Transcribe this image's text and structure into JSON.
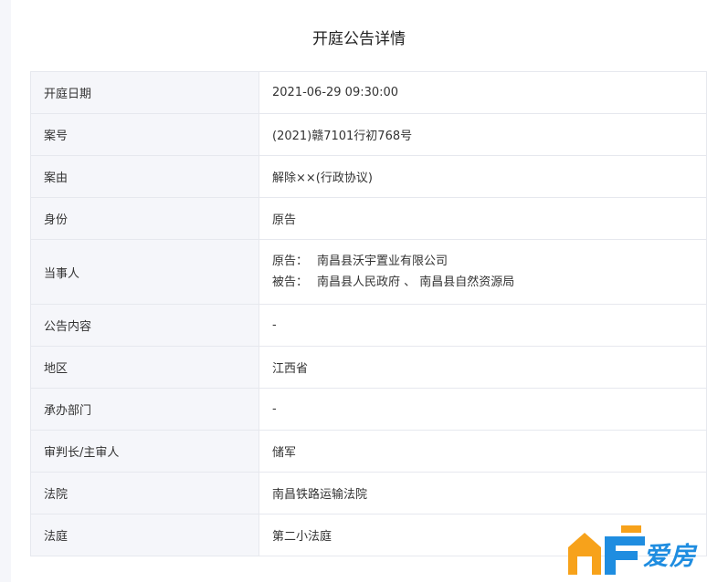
{
  "page": {
    "title": "开庭公告详情"
  },
  "details": [
    {
      "label": "开庭日期",
      "value": "2021-06-29 09:30:00"
    },
    {
      "label": "案号",
      "value": "(2021)赣7101行初768号"
    },
    {
      "label": "案由",
      "value": "解除××(行政协议)"
    },
    {
      "label": "身份",
      "value": "原告"
    },
    {
      "label": "当事人",
      "parties": [
        {
          "role": "原告：",
          "names": "南昌县沃宇置业有限公司"
        },
        {
          "role": "被告：",
          "names": "南昌县人民政府 、 南昌县自然资源局"
        }
      ]
    },
    {
      "label": "公告内容",
      "value": "-"
    },
    {
      "label": "地区",
      "value": "江西省"
    },
    {
      "label": "承办部门",
      "value": "-"
    },
    {
      "label": "审判长/主审人",
      "value": "储军"
    },
    {
      "label": "法院",
      "value": "南昌铁路运输法院"
    },
    {
      "label": "法庭",
      "value": "第二小法庭"
    }
  ],
  "watermark": {
    "text": "爱房",
    "icon": "house-logo-icon",
    "colors": {
      "orange": "#f7a21b",
      "blue": "#1f8de0"
    }
  }
}
